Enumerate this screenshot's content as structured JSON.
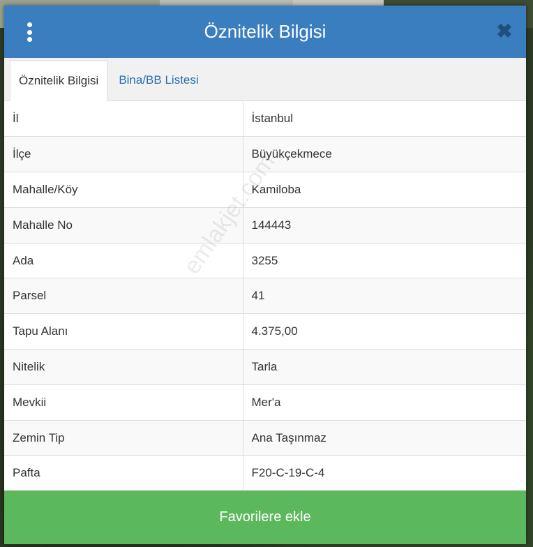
{
  "header": {
    "title": "Öznitelik Bilgisi",
    "menu_icon": "kebab-menu-icon",
    "close_icon": "close-icon",
    "close_glyph": "✖"
  },
  "tabs": [
    {
      "label": "Öznitelik Bilgisi",
      "active": true
    },
    {
      "label": "Bina/BB Listesi",
      "active": false
    }
  ],
  "attributes": [
    {
      "key": "İl",
      "value": "İstanbul"
    },
    {
      "key": "İlçe",
      "value": "Büyükçekmece"
    },
    {
      "key": "Mahalle/Köy",
      "value": "Kamiloba"
    },
    {
      "key": "Mahalle No",
      "value": "144443"
    },
    {
      "key": "Ada",
      "value": "3255"
    },
    {
      "key": "Parsel",
      "value": "41"
    },
    {
      "key": "Tapu Alanı",
      "value": "4.375,00"
    },
    {
      "key": "Nitelik",
      "value": "Tarla"
    },
    {
      "key": "Mevkii",
      "value": "Mer'a"
    },
    {
      "key": "Zemin Tip",
      "value": "Ana Taşınmaz"
    },
    {
      "key": "Pafta",
      "value": "F20-C-19-C-4"
    }
  ],
  "watermark": "emlakjet.com",
  "footer": {
    "favorite_label": "Favorilere ekle"
  },
  "colors": {
    "header_bg": "#3a7ebf",
    "tab_link": "#2a6cb0",
    "button_green": "#5cb85c"
  }
}
